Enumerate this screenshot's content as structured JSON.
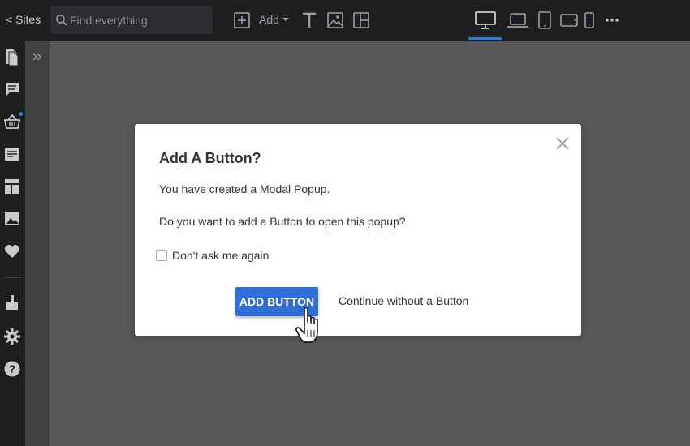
{
  "topbar": {
    "sites_label": "< Sites",
    "search_placeholder": "Find everything",
    "add_label": "Add"
  },
  "modal": {
    "title": "Add A Button?",
    "text1": "You have created a Modal Popup.",
    "text2": "Do you want to add a Button to open this popup?",
    "checkbox_label": "Don't ask me again",
    "checkbox_checked": false,
    "primary_button": "ADD BUTTON",
    "secondary_link": "Continue without a Button"
  },
  "colors": {
    "accent": "#2f6fd6",
    "topbar_bg": "#1c1e20",
    "canvas_dim": "#585858"
  },
  "icons": {
    "left_rail": [
      "pages-icon",
      "chat-icon",
      "store-icon",
      "blog-icon",
      "layout-icon",
      "image-icon",
      "heart-icon",
      "brush-icon",
      "gear-icon",
      "help-icon"
    ],
    "device_modes": [
      "desktop-icon",
      "laptop-icon",
      "tablet-portrait-icon",
      "tablet-landscape-icon",
      "mobile-icon"
    ]
  }
}
